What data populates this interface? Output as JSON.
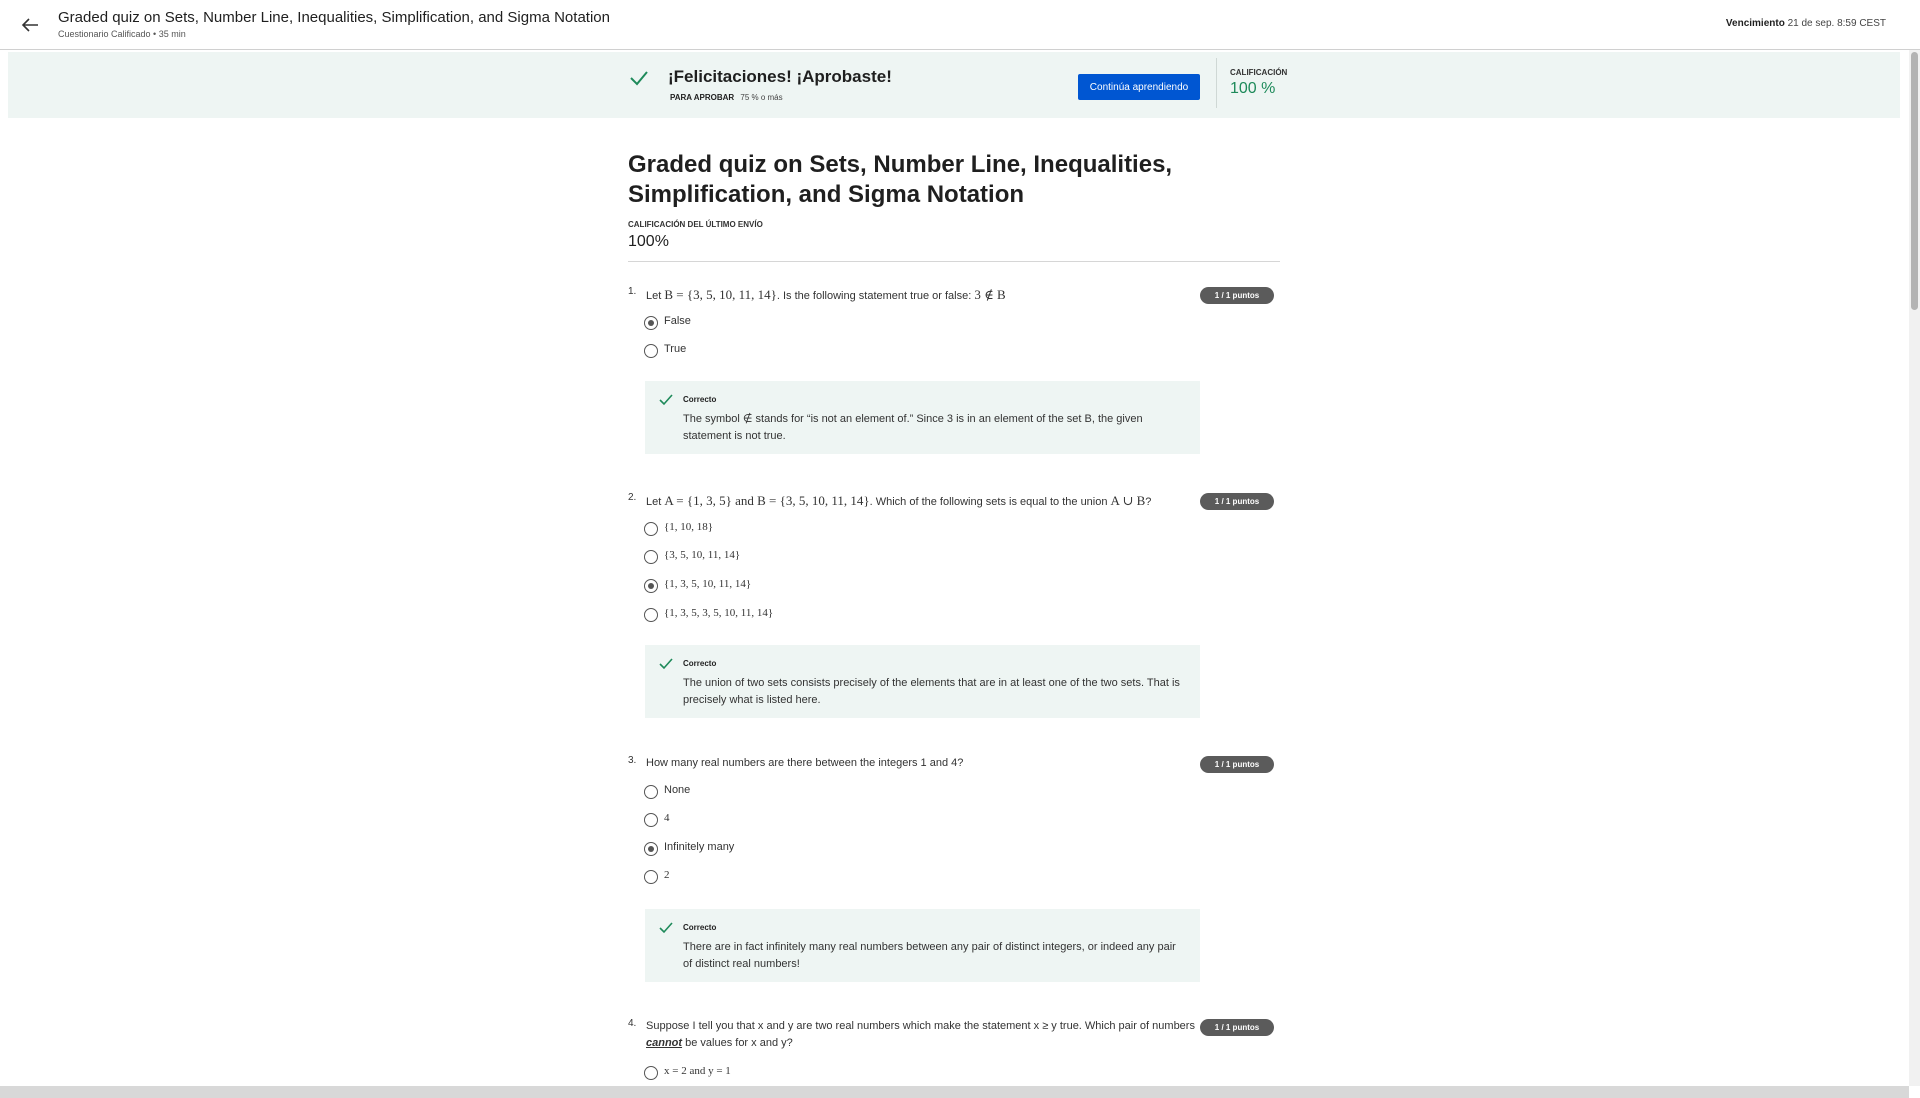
{
  "header": {
    "title": "Graded quiz on Sets, Number Line, Inequalities, Simplification, and Sigma Notation",
    "subtitle": "Cuestionario Calificado • 35 min",
    "due_label": "Vencimiento",
    "due_value": "21 de sep. 8:59 CEST"
  },
  "banner": {
    "title": "¡Felicitaciones! ¡Aprobaste!",
    "pass_label": "PARA APROBAR",
    "pass_value": "75 % o más",
    "continue_label": "Continúa aprendiendo",
    "grade_label": "CALIFICACIÓN",
    "grade_value": "100 %"
  },
  "main": {
    "title": "Graded quiz on Sets, Number Line, Inequalities, Simplification, and Sigma Notation",
    "last_label": "CALIFICACIÓN DEL ÚLTIMO ENVÍO",
    "last_value": "100%"
  },
  "questions": [
    {
      "number": "1.",
      "text_a": "Let ",
      "math_a": "B = {3, 5, 10, 11, 14}",
      "text_b": ". Is the following statement true or false: ",
      "math_b": "3 ∉ B",
      "points": "1 / 1 puntos",
      "options": [
        {
          "label": "False",
          "selected": true
        },
        {
          "label": "True",
          "selected": false
        }
      ],
      "feedback_label": "Correcto",
      "feedback": "The symbol ∉ stands for “is not an element of.” Since 3 is in an element of the set B, the given statement is not true."
    },
    {
      "number": "2.",
      "text_a": "Let ",
      "math_a": "A = {1, 3, 5} and B = {3, 5, 10, 11, 14}",
      "text_b": ". Which of the following sets is equal to the union ",
      "math_b": "A ∪ B",
      "text_c": "?",
      "points": "1 / 1 puntos",
      "options": [
        {
          "label": "{1, 10, 18}",
          "selected": false
        },
        {
          "label": "{3, 5, 10, 11, 14}",
          "selected": false
        },
        {
          "label": "{1, 3, 5, 10, 11, 14}",
          "selected": true
        },
        {
          "label": "{1, 3, 5, 3, 5, 10, 11, 14}",
          "selected": false
        }
      ],
      "feedback_label": "Correcto",
      "feedback": "The union of two sets consists precisely of the elements that are in at least one of the two sets. That is precisely what is listed here."
    },
    {
      "number": "3.",
      "text": "How many real numbers are there between the integers 1 and 4?",
      "points": "1 / 1 puntos",
      "options": [
        {
          "label": "None",
          "selected": false
        },
        {
          "label": "4",
          "selected": false
        },
        {
          "label": "Infinitely many",
          "selected": true
        },
        {
          "label": "2",
          "selected": false
        }
      ],
      "feedback_label": "Correcto",
      "feedback": "There are in fact infinitely many real numbers between any pair of distinct integers, or indeed any pair of distinct real numbers!"
    },
    {
      "number": "4.",
      "text_a": "Suppose I tell you that x and y are two real numbers which make the statement x ≥ y true. Which pair of numbers ",
      "emph": "cannot",
      "text_b": " be values for x and y?",
      "points": "1 / 1 puntos",
      "options": [
        {
          "label": "x = 2 and y = 1",
          "selected": false
        }
      ]
    }
  ]
}
